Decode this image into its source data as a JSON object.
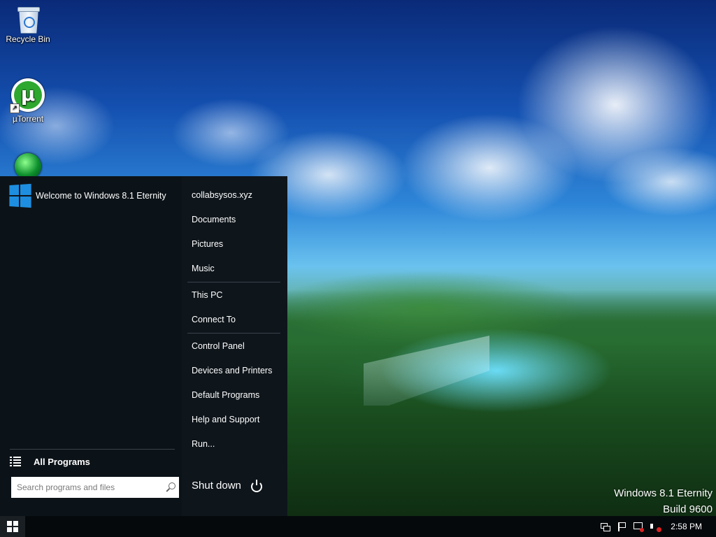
{
  "desktop": {
    "icons": [
      {
        "label": "Recycle Bin",
        "icon": "recycle-bin-icon"
      },
      {
        "label": "µTorrent",
        "icon": "utorrent-icon"
      },
      {
        "label": "",
        "icon": "green-app-icon"
      }
    ],
    "watermark": {
      "line1": "Windows 8.1 Eternity",
      "line2": "Build 9600"
    }
  },
  "start_menu": {
    "header_title": "Welcome to Windows 8.1 Eternity",
    "all_programs": "All Programs",
    "search_placeholder": "Search programs and files",
    "right_items": [
      "collabsysos.xyz",
      "Documents",
      "Pictures",
      "Music",
      "This PC",
      "Connect To",
      "Control Panel",
      "Devices and Printers",
      "Default Programs",
      "Help and Support",
      "Run..."
    ],
    "shutdown_label": "Shut down"
  },
  "taskbar": {
    "clock": "2:58 PM",
    "tray_icons": [
      "action-center-icon",
      "flag-icon",
      "network-icon",
      "volume-muted-icon"
    ]
  },
  "colors": {
    "start_bg": "#0e151b",
    "accent": "#1e8fe0",
    "taskbar_bg": "#05090c"
  }
}
